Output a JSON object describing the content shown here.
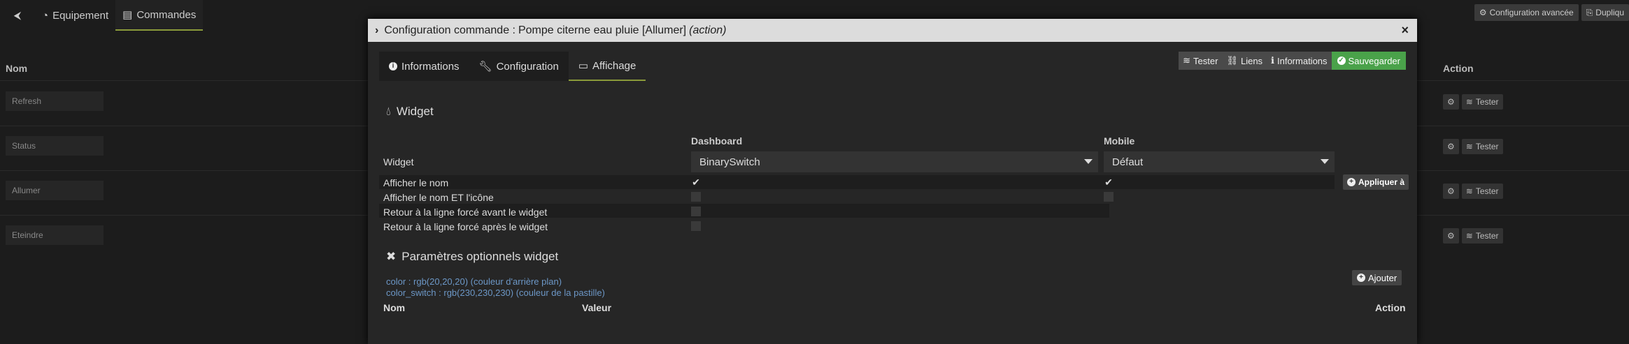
{
  "background": {
    "tabs": {
      "equipment": "Equipement",
      "commands": "Commandes"
    },
    "top_right": {
      "advanced": "Configuration avancée",
      "duplicate": "Dupliqu"
    },
    "headers": {
      "name": "Nom",
      "action": "Action"
    },
    "commands": [
      "Refresh",
      "Status",
      "Allumer",
      "Eteindre"
    ],
    "test_label": "Tester"
  },
  "modal": {
    "title_prefix": "Configuration commande : ",
    "title_name": "Pompe citerne eau pluie [Allumer]",
    "title_type": "(action)",
    "close": "×",
    "tabs": {
      "info": "Informations",
      "config": "Configuration",
      "display": "Affichage"
    },
    "toolbar": {
      "test": "Tester",
      "links": "Liens",
      "info": "Informations",
      "save": "Sauvegarder"
    },
    "widget": {
      "section_title": "Widget",
      "col_dashboard": "Dashboard",
      "col_mobile": "Mobile",
      "widget_label": "Widget",
      "dashboard_value": "BinarySwitch",
      "mobile_value": "Défaut",
      "apply_label": "Appliquer à",
      "options": [
        {
          "label": "Afficher le nom",
          "dashboard": true,
          "mobile": true
        },
        {
          "label": "Afficher le nom ET l'icône",
          "dashboard": false,
          "mobile": false
        },
        {
          "label": "Retour à la ligne forcé avant le widget",
          "dashboard": false
        },
        {
          "label": "Retour à la ligne forcé après le widget",
          "dashboard": false
        }
      ]
    },
    "optional": {
      "section_title": "Paramètres optionnels widget",
      "add_label": "Ajouter",
      "params": [
        "color : rgb(20,20,20) (couleur d'arrière plan)",
        "color_switch : rgb(230,230,230) (couleur de la pastille)"
      ],
      "table_headers": {
        "name": "Nom",
        "value": "Valeur",
        "action": "Action"
      }
    }
  }
}
